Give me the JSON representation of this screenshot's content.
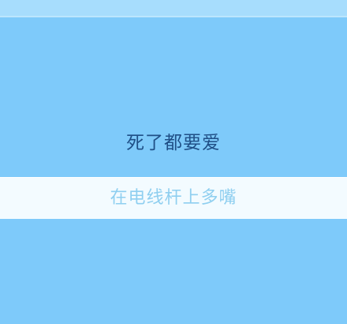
{
  "main": {
    "title": "死了都要爱",
    "subtitle": "在电线杆上多嘴"
  },
  "colors": {
    "background": "#7ecafa",
    "top_band": "#a7ddfd",
    "title_text": "#1f4f86",
    "band": "#f3fbff",
    "subtitle_text": "#8fcff0"
  }
}
